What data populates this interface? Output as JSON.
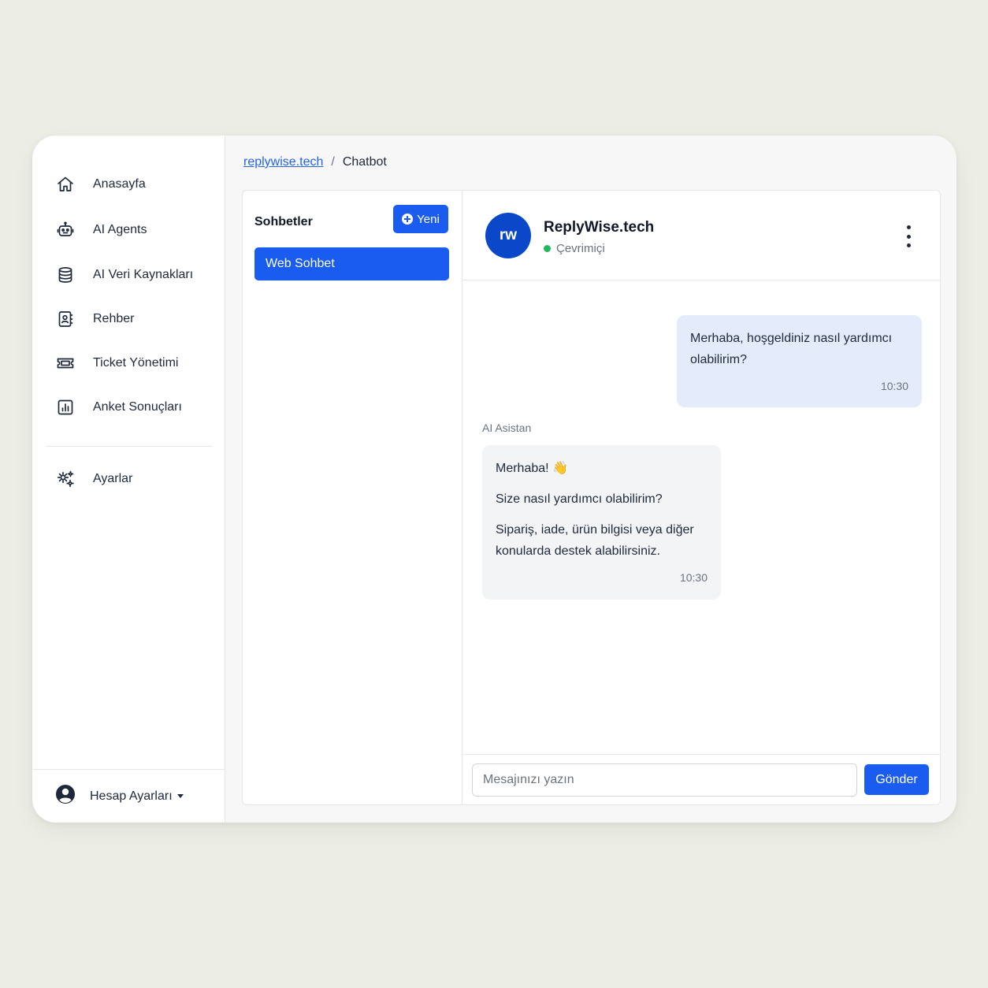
{
  "sidebar": {
    "items": [
      {
        "label": "Anasayfa",
        "icon": "home-icon"
      },
      {
        "label": "AI Agents",
        "icon": "robot-icon"
      },
      {
        "label": "AI Veri Kaynakları",
        "icon": "database-icon"
      },
      {
        "label": "Rehber",
        "icon": "contacts-book-icon"
      },
      {
        "label": "Ticket Yönetimi",
        "icon": "ticket-icon"
      },
      {
        "label": "Anket Sonuçları",
        "icon": "bar-chart-icon"
      },
      {
        "label": "Ayarlar",
        "icon": "settings-gears-icon"
      }
    ],
    "account": {
      "label": "Hesap Ayarları",
      "icon": "user-circle-icon"
    }
  },
  "breadcrumb": {
    "link": "replywise.tech",
    "separator": "/",
    "current": "Chatbot"
  },
  "conversations": {
    "title": "Sohbetler",
    "new_button": "Yeni",
    "items": [
      {
        "label": "Web Sohbet",
        "active": true
      }
    ]
  },
  "chat": {
    "avatar_initials": "rw",
    "name": "ReplyWise.tech",
    "status": "Çevrimiçi",
    "messages": [
      {
        "sender": "user",
        "text": "Merhaba, hoşgeldiniz nasıl yardımcı olabilirim?",
        "time": "10:30"
      },
      {
        "sender": "ai",
        "sender_label": "AI Asistan",
        "paragraphs": [
          "Merhaba! 👋",
          "Size nasıl yardımcı olabilirim?",
          "Sipariş, iade, ürün bilgisi veya diğer konularda destek alabilirsiniz."
        ],
        "time": "10:30"
      }
    ],
    "input_placeholder": "Mesajınızı yazın",
    "input_value": "",
    "send_button": "Gönder"
  },
  "colors": {
    "accent": "#1a5cf0",
    "avatar_bg": "#0b47c9",
    "status_online": "#22b95e",
    "user_bubble": "#e4ecfc",
    "ai_bubble": "#f3f4f6",
    "page_bg": "#eceee6"
  }
}
